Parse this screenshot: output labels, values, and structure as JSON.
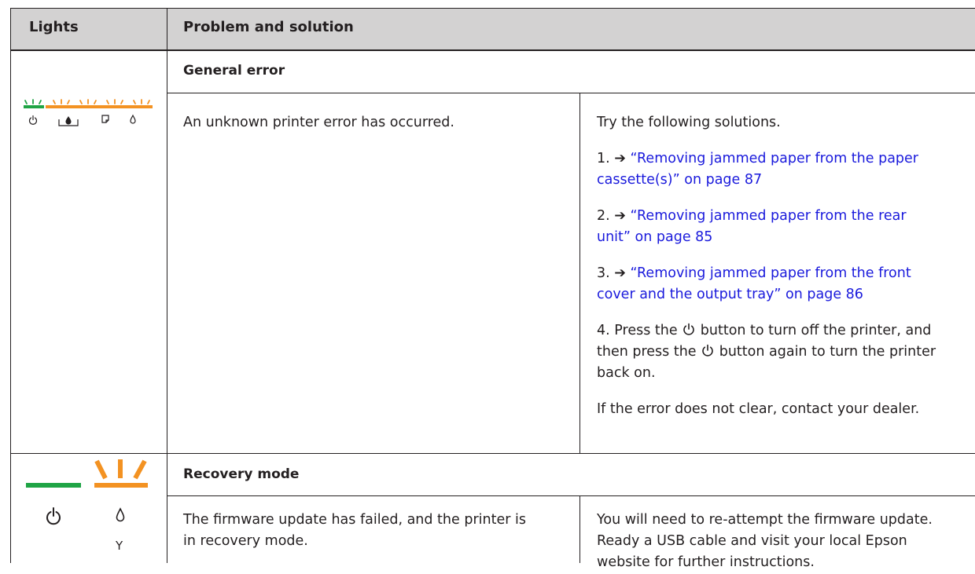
{
  "header": {
    "col_lights": "Lights",
    "col_problem": "Problem and solution"
  },
  "colors": {
    "green": "#1fa445",
    "orange": "#f39222",
    "link": "#1a1adc",
    "header_bg": "#d3d2d2"
  },
  "general_error": {
    "title": "General error",
    "problem": "An unknown printer error has occurred.",
    "intro": "Try the following solutions.",
    "step1_num": "1.",
    "step1_link_l1": "“Removing jammed paper from the paper",
    "step1_link_l2": "cassette(s)” on page 87",
    "step2_num": "2.",
    "step2_link_l1": "“Removing jammed paper from the rear",
    "step2_link_l2": "unit” on page 85",
    "step3_num": "3.",
    "step3_link_l1": "“Removing jammed paper from the front",
    "step3_link_l2": "cover and the output tray” on page 86",
    "step4_a": "4. Press the",
    "step4_b": "button to turn off the printer, and",
    "step4_c": "then press the",
    "step4_d": "button again to turn the printer",
    "step4_e": "back on.",
    "final": "If the error does not clear, contact your dealer.",
    "lights": [
      "power-light-green-flashing",
      "ink-light-orange-flashing",
      "paper-light-orange-flashing",
      "ink-drop-light-orange-flashing"
    ]
  },
  "recovery_mode": {
    "title": "Recovery mode",
    "problem_l1": "The firmware update has failed, and the printer is",
    "problem_l2": "in recovery mode.",
    "solution_l1": "You will need to re-attempt the firmware update.",
    "solution_l2": "Ready a USB cable and visit your local Epson",
    "solution_l3": "website for further instructions.",
    "ink_label": "Y",
    "lights": [
      "power-light-green-on",
      "ink-light-orange-flashing"
    ]
  }
}
